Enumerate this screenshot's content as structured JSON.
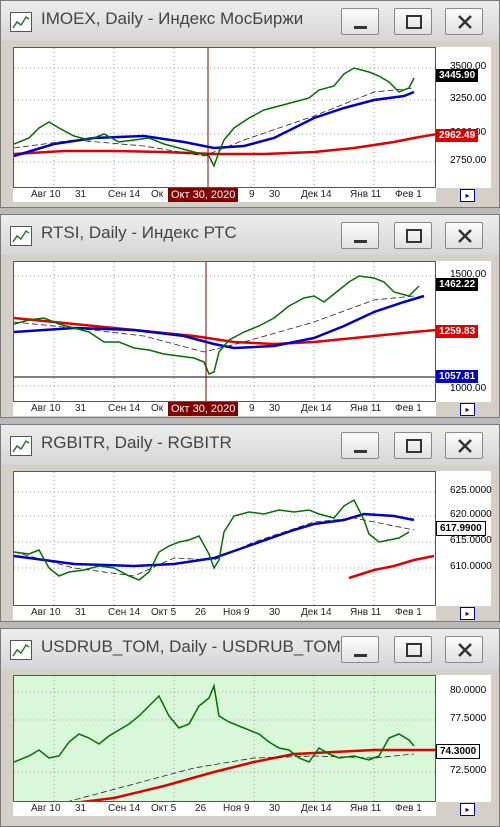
{
  "windows": [
    {
      "title": "IMOEX, Daily - Индекс МосБиржи",
      "bg": "#ffffff",
      "ticks": [
        "3500.00",
        "3250.00",
        "3000.00",
        "2750.00"
      ],
      "tags": [
        {
          "text": "3445.90",
          "bg": "#000000",
          "fg": "#ffffff"
        },
        {
          "text": "2962.49",
          "bg": "#e00000",
          "fg": "#ffffff"
        }
      ],
      "xlabels": [
        "Авг 10",
        "31",
        "Сен 14",
        "Ок",
        "9",
        "30",
        "Дек 14",
        "Янв 11",
        "Фев 1"
      ],
      "crosshair_label": "Окт 30, 2020",
      "chart_data": {
        "type": "line",
        "ylim": [
          2600,
          3600
        ],
        "close_start": 2900,
        "close_end": 3445.9,
        "ma_slow": [
          2870,
          2870,
          2880,
          2880,
          2880,
          2900,
          2930,
          2962.49
        ],
        "ma_fast": [
          2900,
          2950,
          2980,
          2920,
          2960,
          3150,
          3300,
          3340
        ]
      }
    },
    {
      "title": "RTSI, Daily - Индекс РТС",
      "bg": "#ffffff",
      "ticks": [
        "1500.00",
        "1000.00"
      ],
      "tags": [
        {
          "text": "1462.22",
          "bg": "#000000",
          "fg": "#ffffff"
        },
        {
          "text": "1259.83",
          "bg": "#e00000",
          "fg": "#ffffff"
        },
        {
          "text": "1057.81",
          "bg": "#0000cc",
          "fg": "#ffffff"
        }
      ],
      "xlabels": [
        "Авг 10",
        "31",
        "Сен 14",
        "Ок",
        "9",
        "30",
        "Дек 14",
        "Янв 11",
        "Фев 1"
      ],
      "crosshair_label": "Окт 30, 2020",
      "chart_data": {
        "type": "line",
        "ylim": [
          980,
          1520
        ],
        "ma_slow": [
          1330,
          1300,
          1270,
          1230,
          1210,
          1220,
          1240,
          1259.83
        ],
        "ma_fast": [
          1290,
          1290,
          1270,
          1230,
          1200,
          1270,
          1380,
          1430
        ]
      }
    },
    {
      "title": "RGBITR, Daily - RGBITR",
      "bg": "#ffffff",
      "ticks": [
        "625.0000",
        "620.0000",
        "615.0000",
        "610.0000"
      ],
      "tags": [
        {
          "text": "617.9900",
          "bg": "#ffffff",
          "fg": "#000000"
        }
      ],
      "xlabels": [
        "Авг 10",
        "31",
        "Сен 14",
        "Окт 5",
        "26",
        "Ноя 9",
        "30",
        "Дек 14",
        "Янв 11",
        "Фев 1"
      ],
      "crosshair_label": "",
      "chart_data": {
        "type": "line",
        "ylim": [
          605,
          627
        ],
        "ma_fast": [
          612,
          610,
          609,
          609,
          611,
          614,
          617,
          619,
          618,
          618
        ]
      }
    },
    {
      "title": "USDRUB_TOM, Daily - USDRUB_TOM",
      "bg": "#d9f7d9",
      "ticks": [
        "80.0000",
        "77.5000",
        "72.5000"
      ],
      "tags": [
        {
          "text": "74.3000",
          "bg": "#ffffff",
          "fg": "#000000"
        }
      ],
      "xlabels": [
        "Авг 10",
        "31",
        "Сен 14",
        "Окт 5",
        "26",
        "Ноя 9",
        "30",
        "Дек 14",
        "Янв 11",
        "Фев 1"
      ],
      "crosshair_label": "",
      "chart_data": {
        "type": "line",
        "ylim": [
          70,
          82
        ],
        "ma_slow": [
          70,
          70.5,
          71.5,
          72.5,
          73.5,
          74,
          74.2,
          74.3
        ]
      }
    }
  ]
}
